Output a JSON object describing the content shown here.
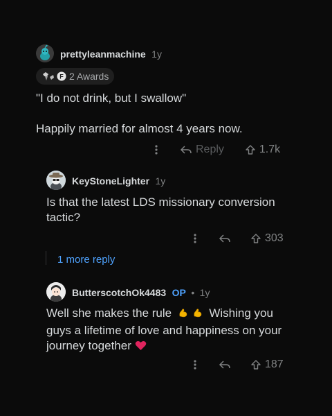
{
  "comment1": {
    "username": "prettyleanmachine",
    "age": "1y",
    "awards_label": "2 Awards",
    "line1": "\"I do not drink, but I swallow\"",
    "line2": "Happily married for almost 4 years now.",
    "reply_label": "Reply",
    "votes": "1.7k"
  },
  "comment2": {
    "username": "KeyStoneLighter",
    "age": "1y",
    "text": "Is that the latest LDS missionary conversion tactic?",
    "votes": "303"
  },
  "more_replies": "1 more reply",
  "comment3": {
    "username": "ButterscotchOk4483",
    "op_badge": "OP",
    "separator": "•",
    "age": "1y",
    "text_part1": "Well she makes the rule",
    "text_part2": "Wishing you guys a lifetime of love and happiness on your journey together",
    "votes": "187"
  },
  "icons": [
    "reddit-avatar-icon",
    "award-icon",
    "overflow-icon",
    "reply-arrow-icon",
    "upvote-icon",
    "flexed-biceps-icon",
    "heart-icon"
  ],
  "colors": {
    "background": "#0b0b0b",
    "text": "#d7dadc",
    "muted": "#818384",
    "link": "#4fa3ff",
    "heart": "#e0245e"
  }
}
